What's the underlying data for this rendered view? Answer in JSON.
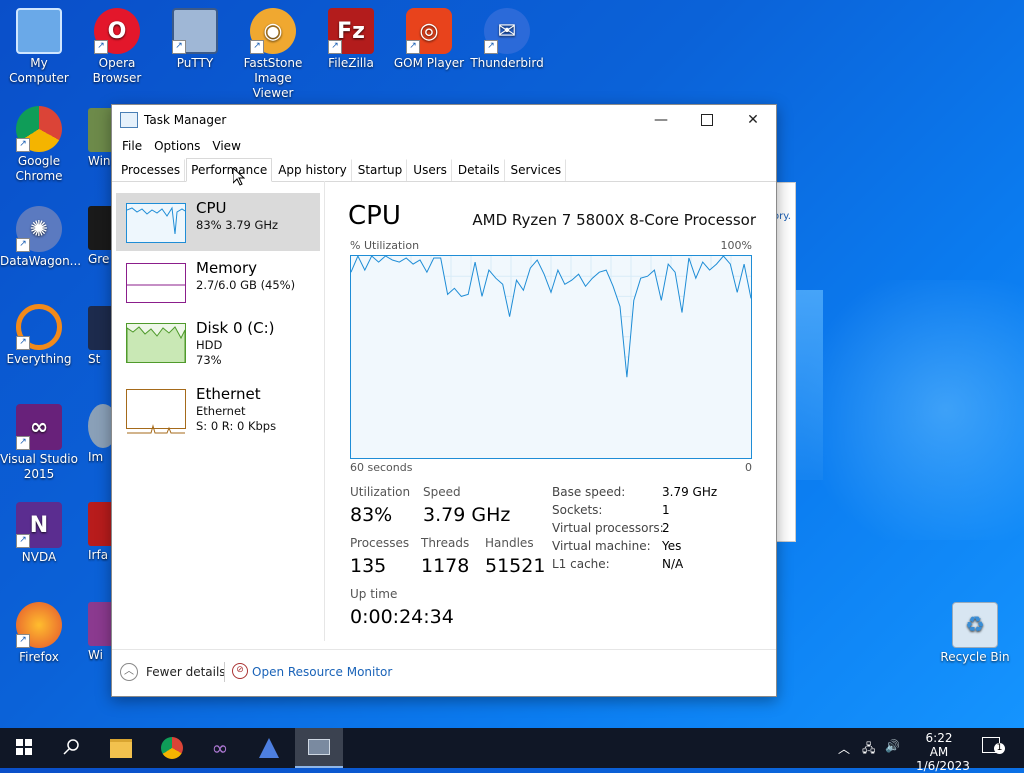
{
  "desktop": {
    "icons": [
      {
        "label": "My Computer"
      },
      {
        "label": "Opera Browser"
      },
      {
        "label": "PuTTY"
      },
      {
        "label": "FastStone Image Viewer"
      },
      {
        "label": "FileZilla"
      },
      {
        "label": "GOM Player"
      },
      {
        "label": "Thunderbird"
      },
      {
        "label": "Google Chrome"
      },
      {
        "label": "DataWagon..."
      },
      {
        "label": "Everything"
      },
      {
        "label": "Visual Studio 2015"
      },
      {
        "label": "NVDA"
      },
      {
        "label": "Firefox"
      },
      {
        "label": "Recycle Bin"
      }
    ],
    "partial_labels": [
      "Win",
      "Gre",
      "St",
      "Im",
      "Irfa",
      "Wi"
    ],
    "bg_window_text": "ory."
  },
  "taskmanager": {
    "title": "Task Manager",
    "menu": [
      "File",
      "Options",
      "View"
    ],
    "tabs": [
      "Processes",
      "Performance",
      "App history",
      "Startup",
      "Users",
      "Details",
      "Services"
    ],
    "active_tab": "Performance",
    "resources": [
      {
        "name": "CPU",
        "sub1": "83%  3.79 GHz",
        "sub2": ""
      },
      {
        "name": "Memory",
        "sub1": "2.7/6.0 GB (45%)",
        "sub2": ""
      },
      {
        "name": "Disk 0 (C:)",
        "sub1": "HDD",
        "sub2": "73%"
      },
      {
        "name": "Ethernet",
        "sub1": "Ethernet",
        "sub2": "S: 0  R: 0 Kbps"
      }
    ],
    "cpu": {
      "heading": "CPU",
      "model": "AMD Ryzen 7 5800X 8-Core Processor",
      "util_label": "% Utilization",
      "max_label": "100%",
      "time_label": "60 seconds",
      "zero_label": "0",
      "utilization_label": "Utilization",
      "utilization": "83%",
      "speed_label": "Speed",
      "speed": "3.79 GHz",
      "processes_label": "Processes",
      "processes": "135",
      "threads_label": "Threads",
      "threads": "1178",
      "handles_label": "Handles",
      "handles": "51521",
      "uptime_label": "Up time",
      "uptime": "0:00:24:34",
      "details": [
        {
          "k": "Base speed:",
          "v": "3.79 GHz"
        },
        {
          "k": "Sockets:",
          "v": "1"
        },
        {
          "k": "Virtual processors:",
          "v": "2"
        },
        {
          "k": "Virtual machine:",
          "v": "Yes"
        },
        {
          "k": "L1 cache:",
          "v": "N/A"
        }
      ],
      "history": [
        92,
        100,
        93,
        100,
        97,
        100,
        98,
        97,
        99,
        96,
        98,
        92,
        99,
        99,
        81,
        84,
        80,
        81,
        97,
        80,
        93,
        89,
        86,
        70,
        88,
        83,
        94,
        98,
        91,
        82,
        93,
        86,
        88,
        91,
        85,
        89,
        92,
        93,
        85,
        75,
        40,
        78,
        89,
        90,
        93,
        78,
        96,
        92,
        72,
        99,
        89,
        97,
        93,
        96,
        100,
        96,
        82,
        96,
        79
      ]
    },
    "footer": {
      "fewer": "Fewer details",
      "resmon": "Open Resource Monitor"
    }
  },
  "taskbar": {
    "time": "6:22 AM",
    "date": "1/6/2023",
    "notif_count": "1"
  }
}
